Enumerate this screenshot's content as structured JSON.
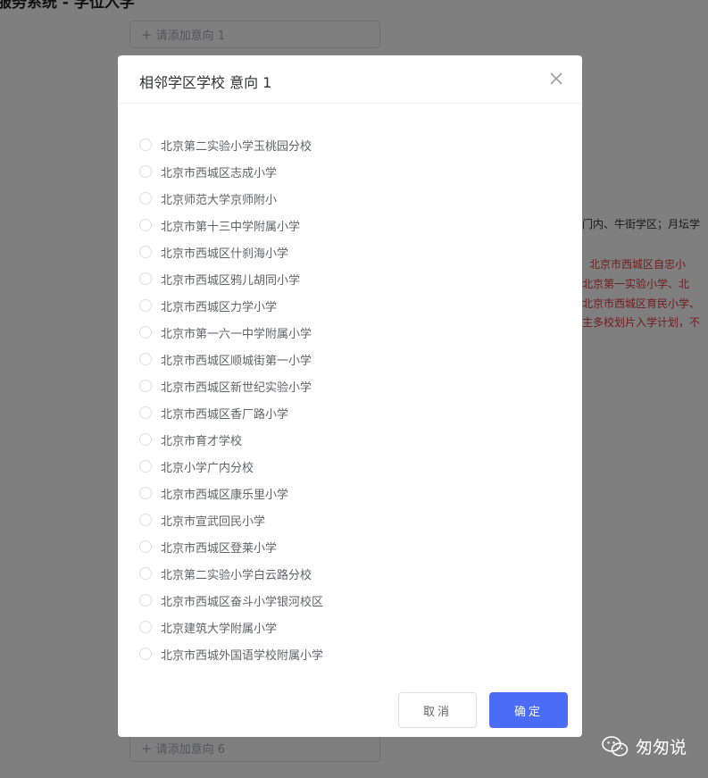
{
  "background": {
    "page_title": "服务系统 - 学位入学",
    "intent_boxes": [
      "请添加意向 1",
      "请添加意向 6"
    ],
    "info_line": "门内、牛街学区；月坛学",
    "notice_lines": [
      "北京市西城区自忠小",
      "北京第一实验小学、北",
      "北京市西城区育民小学、",
      "主多校划片入学计划，不"
    ]
  },
  "dialog": {
    "title": "相邻学区学校 意向 1",
    "schools": [
      "北京第二实验小学玉桃园分校",
      "北京市西城区志成小学",
      "北京师范大学京师附小",
      "北京市第十三中学附属小学",
      "北京市西城区什刹海小学",
      "北京市西城区鸦儿胡同小学",
      "北京市西城区力学小学",
      "北京市第一六一中学附属小学",
      "北京市西城区顺城街第一小学",
      "北京市西城区新世纪实验小学",
      "北京市西城区香厂路小学",
      "北京市育才学校",
      "北京小学广内分校",
      "北京市西城区康乐里小学",
      "北京市宣武回民小学",
      "北京市西城区登莱小学",
      "北京第二实验小学白云路分校",
      "北京市西城区奋斗小学银河校区",
      "北京建筑大学附属小学",
      "北京市西城外国语学校附属小学"
    ],
    "cancel_label": "取消",
    "confirm_label": "确定"
  },
  "watermark": {
    "text": "匆匆说"
  },
  "colors": {
    "primary": "#4a6cf7",
    "overlay": "rgba(0,0,0,0.5)",
    "notice_red": "#e4393c"
  },
  "icons": {
    "close": "close-icon",
    "plus": "plus-icon",
    "radio": "radio-icon",
    "watermark": "wechat-icon"
  }
}
